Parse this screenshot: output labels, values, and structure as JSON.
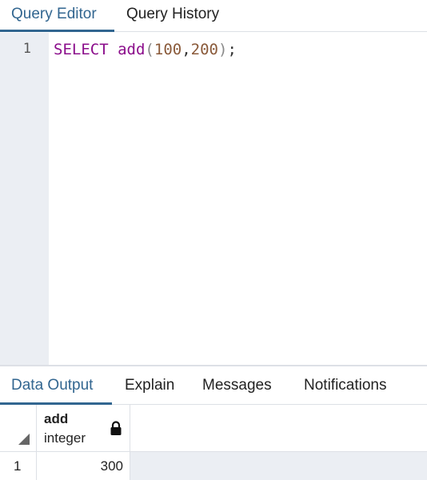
{
  "top_tabs": {
    "query_editor": "Query Editor",
    "query_history": "Query History"
  },
  "editor": {
    "line_number": "1",
    "tokens": {
      "keyword": "SELECT",
      "space": " ",
      "function": "add",
      "paren_open": "(",
      "arg1": "100",
      "comma": ",",
      "arg2": "200",
      "paren_close": ")",
      "semicolon": ";"
    }
  },
  "bottom_tabs": {
    "data_output": "Data Output",
    "explain": "Explain",
    "messages": "Messages",
    "notifications": "Notifications"
  },
  "grid": {
    "column": {
      "name": "add",
      "type": "integer"
    },
    "rows": [
      {
        "num": "1",
        "value": "300"
      }
    ]
  },
  "icons": {
    "lock": "lock-icon",
    "sort_corner": "select-all-triangle-icon"
  },
  "colors": {
    "accent": "#326690",
    "keyword": "#8b0d8b",
    "number": "#8a5a3a",
    "gutter": "#ebeef3"
  }
}
